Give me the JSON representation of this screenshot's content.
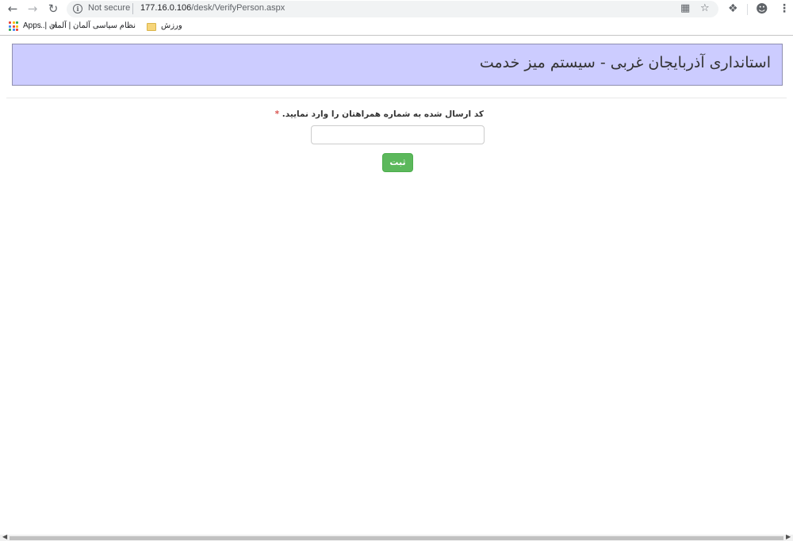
{
  "browser": {
    "security_label": "Not secure",
    "url_host": "177.16.0.106",
    "url_path": "/desk/VerifyPerson.aspx",
    "bookmarks": [
      {
        "label": "Apps"
      },
      {
        "label": "نظام سیاسی آلمان | آلمان |..."
      },
      {
        "label": "ورزش"
      }
    ],
    "apps_colors": [
      "#ea4335",
      "#fbbc05",
      "#34a853",
      "#4285f4",
      "#ea4335",
      "#fbbc05",
      "#34a853",
      "#4285f4",
      "#ea4335"
    ]
  },
  "page": {
    "header_title": "استانداری آذربایجان غربی - سیستم میز خدمت",
    "header_bg": "#ccccff",
    "field_label": "کد ارسال شده به شماره همراهتان را وارد نمایید.",
    "required_mark": "*",
    "code_value": "",
    "submit_label": "ثبت",
    "submit_color": "#5cb85c"
  }
}
